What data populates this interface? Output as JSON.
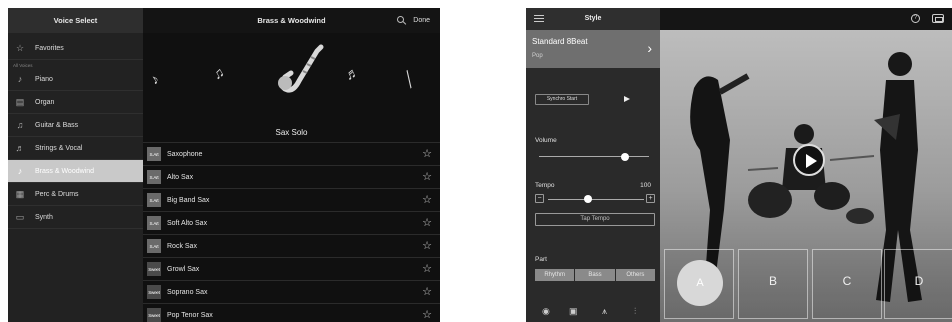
{
  "left_screen": {
    "sidebar_header": "Voice Select",
    "main_header": "Brass & Woodwind",
    "done_label": "Done",
    "favorites": "Favorites",
    "section_label": "All Voices",
    "categories": [
      {
        "label": "Piano",
        "icon": "piano-icon"
      },
      {
        "label": "Organ",
        "icon": "organ-icon"
      },
      {
        "label": "Guitar & Bass",
        "icon": "guitar-icon"
      },
      {
        "label": "Strings & Vocal",
        "icon": "violin-icon"
      },
      {
        "label": "Brass & Woodwind",
        "icon": "saxophone-icon",
        "active": true
      },
      {
        "label": "Perc & Drums",
        "icon": "drums-icon"
      },
      {
        "label": "Synth",
        "icon": "synth-icon"
      }
    ],
    "selected_voice": "Sax Solo",
    "voices": [
      {
        "badge": "S.Art",
        "name": "Saxophone"
      },
      {
        "badge": "S.Art",
        "name": "Alto Sax"
      },
      {
        "badge": "S.Art",
        "name": "Big Band Sax"
      },
      {
        "badge": "S.Art",
        "name": "Soft Alto Sax"
      },
      {
        "badge": "S.Art",
        "name": "Rock Sax"
      },
      {
        "badge": "Sweet",
        "name": "Growl Sax"
      },
      {
        "badge": "Sweet",
        "name": "Soprano Sax"
      },
      {
        "badge": "Sweet",
        "name": "Pop Tenor Sax"
      }
    ],
    "accent_color": "#c9c9c9"
  },
  "right_screen": {
    "header_title": "Style",
    "style_name": "Standard 8Beat",
    "style_category": "Pop",
    "synchro_start": "Synchro Start",
    "volume_label": "Volume",
    "volume_level": 0.78,
    "tempo_label": "Tempo",
    "tempo_value": "100",
    "tempo_level": 0.42,
    "tap_tempo": "Tap Tempo",
    "part_label": "Part",
    "parts": [
      "Rhythm",
      "Bass",
      "Others"
    ],
    "sections": [
      "A",
      "B",
      "C",
      "D"
    ],
    "active_section": "A"
  }
}
